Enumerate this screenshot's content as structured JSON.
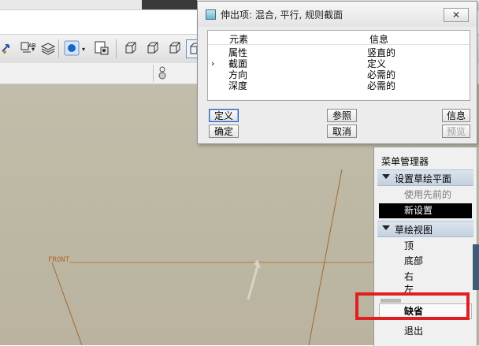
{
  "dialog": {
    "title": "伸出项: 混合, 平行, 规则截面",
    "close_label": "✕",
    "columns": {
      "element": "元素",
      "info": "信息"
    },
    "rows": [
      {
        "element": "属性",
        "info": "竖直的",
        "current": false
      },
      {
        "element": "截面",
        "info": "定义",
        "current": true
      },
      {
        "element": "方向",
        "info": "必需的",
        "current": false
      },
      {
        "element": "深度",
        "info": "必需的",
        "current": false
      }
    ],
    "current_marker": "›",
    "buttons": {
      "define": "定义",
      "reference": "参照",
      "info": "信息",
      "ok": "确定",
      "cancel": "取消",
      "preview": "预览"
    }
  },
  "menu_manager": {
    "title": "菜单管理器",
    "sections": [
      {
        "label": "设置草绘平面",
        "items": [
          "使用先前的",
          "新设置"
        ]
      },
      {
        "label": "草绘视图",
        "items": [
          "顶",
          "底部",
          "右",
          "左",
          "缺省",
          "退出"
        ]
      }
    ]
  },
  "viewport": {
    "datum_label": "FRONT"
  },
  "colors": {
    "highlight": "#e02020",
    "datum": "#b06a2a",
    "viewport_bg": "#bdb8a4"
  }
}
